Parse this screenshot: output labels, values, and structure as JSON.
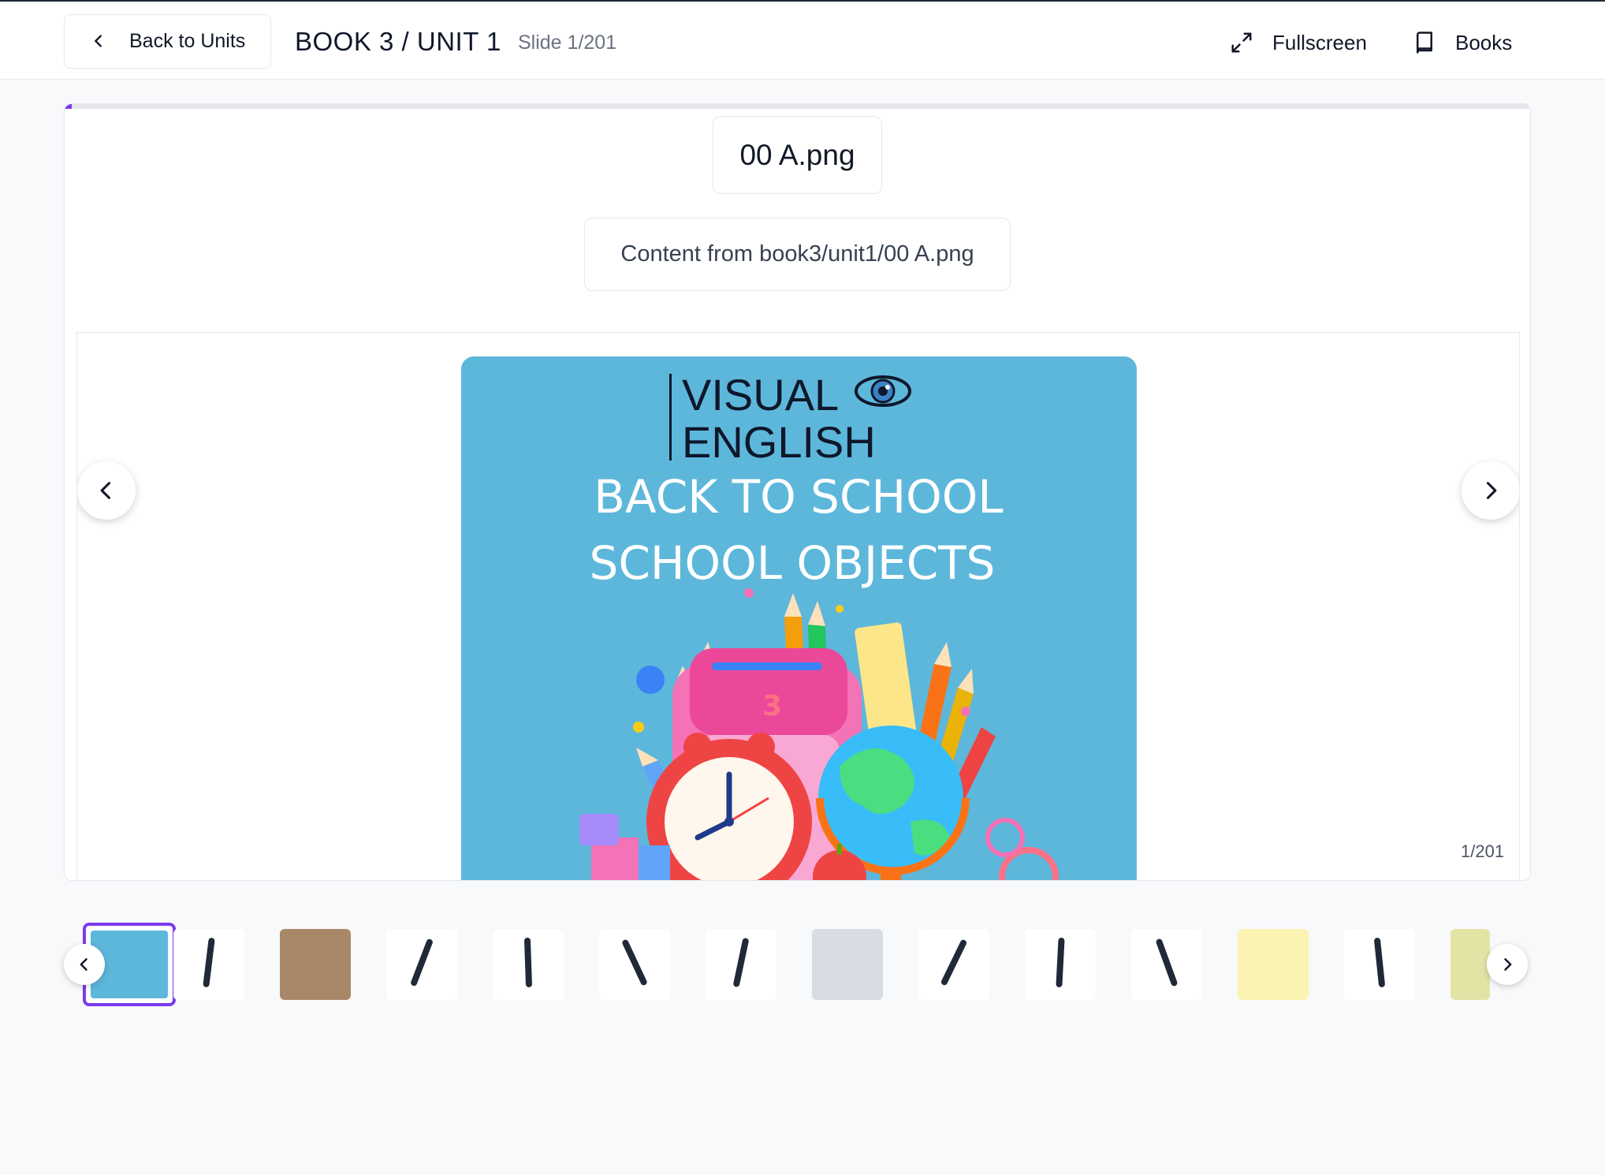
{
  "header": {
    "back_label": "Back to Units",
    "title": "BOOK 3 / UNIT 1",
    "slide_counter": "Slide 1/201",
    "fullscreen_label": "Fullscreen",
    "books_label": "Books"
  },
  "slide": {
    "file_title": "00 A.png",
    "content_caption": "Content from book3/unit1/00 A.png",
    "pager": "1/201",
    "progress_fraction": 0.005,
    "image": {
      "logo_line1": "VISUAL",
      "logo_line2": "ENGLISH",
      "heading_line1": "BACK TO SCHOOL",
      "heading_line2": "SCHOOL OBJECTS",
      "background_color": "#5db7db"
    }
  },
  "thumbnails": {
    "active_index": 0,
    "items": [
      {
        "name": "slide-cover",
        "color": "#5db7db"
      },
      {
        "name": "pen-black",
        "color": "#ffffff"
      },
      {
        "name": "pencils-in-hand",
        "color": "#a9886a"
      },
      {
        "name": "unicorn-pen",
        "color": "#ffffff"
      },
      {
        "name": "red-figure-pen",
        "color": "#ffffff"
      },
      {
        "name": "gold-pen",
        "color": "#ffffff"
      },
      {
        "name": "orange-pencil",
        "color": "#ffffff"
      },
      {
        "name": "pen-in-hands",
        "color": "#d9dde3"
      },
      {
        "name": "blue-pen",
        "color": "#ffffff"
      },
      {
        "name": "parker-pen",
        "color": "#ffffff"
      },
      {
        "name": "colored-markers",
        "color": "#ffffff"
      },
      {
        "name": "pen-on-yellow",
        "color": "#faf3b1"
      },
      {
        "name": "gel-pens",
        "color": "#ffffff"
      },
      {
        "name": "partial-thumb",
        "color": "#e4e3a6"
      }
    ]
  },
  "colors": {
    "accent": "#7c3aed",
    "slide_bg": "#5db7db"
  },
  "icons": {
    "back": "chevron-left-icon",
    "fullscreen": "expand-icon",
    "books": "book-icon",
    "prev": "chevron-left-icon",
    "next": "chevron-right-icon"
  }
}
